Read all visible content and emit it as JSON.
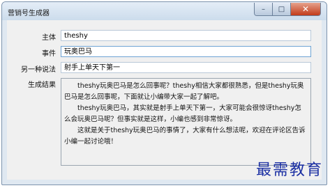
{
  "window": {
    "title": "营销号生成器"
  },
  "controls": {
    "minimize": "–",
    "maximize": "□",
    "close": "✕"
  },
  "form": {
    "subject_label": "主体",
    "subject_value": "theshy",
    "event_label": "事件",
    "event_value": "玩奥巴马",
    "alt_label": "另一种说法",
    "alt_value": "射手上单天下第一",
    "result_label": "生成结果"
  },
  "result": {
    "paragraphs": [
      "theshy玩奥巴马是怎么回事呢？theshy相信大家都很熟悉，但是theshy玩奥巴马是怎么回事呢，下面就让小编带大家一起了解吧。",
      "theshy玩奥巴马，其实就是射手上单天下第一，大家可能会很惊讶theshy怎么会玩奥巴马呢？但事实就是这样，小编也感到非常惊讶。",
      "这就是关于theshy玩奥巴马的事情了，大家有什么想法呢，欢迎在评论区告诉小编一起讨论哦！"
    ]
  },
  "watermark": "最需教育"
}
